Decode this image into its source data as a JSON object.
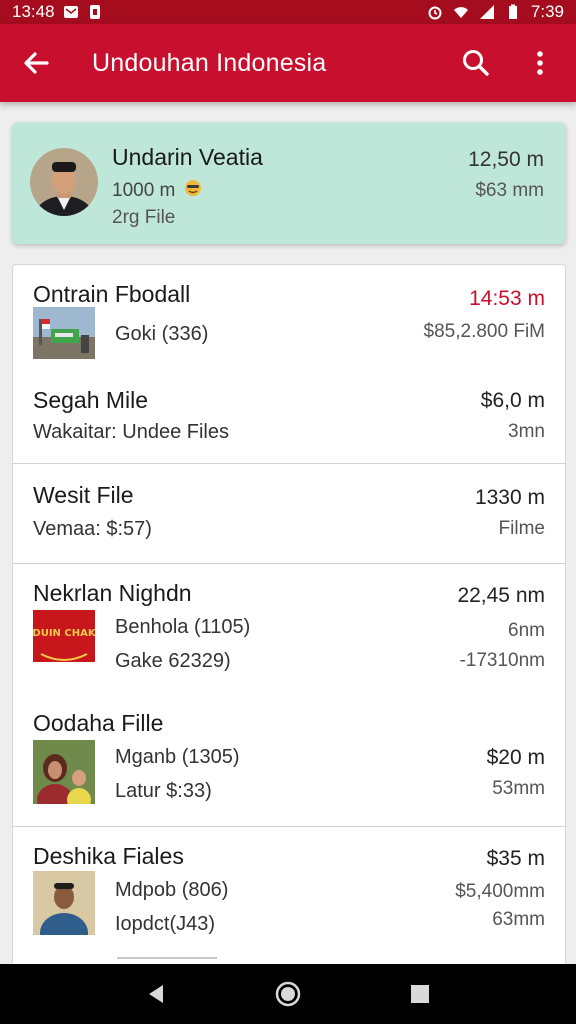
{
  "status_bar": {
    "time_left": "13:48",
    "time_right": "7:39"
  },
  "app_bar": {
    "title": "Undouhan Indonesia",
    "icons": [
      "back-arrow-icon",
      "search-icon",
      "more-vert-icon"
    ]
  },
  "featured": {
    "name": "Undarin Veatia",
    "meta": "1000 m",
    "sub": "2rg File",
    "right_top": "12,50 m",
    "right_bottom": "$63 mm"
  },
  "items": [
    {
      "title": "Ontrain Fbodall",
      "line1": "Goki (336)",
      "right1": "14:53 m",
      "right2": "$85,2.800 FiM"
    },
    {
      "title": "Segah Mile",
      "line1": "Wakaitar: Undee Files",
      "right1": "$6,0 m",
      "right2": "3mn"
    },
    {
      "title": "Wesit File",
      "line1": "Vemaa: $:57)",
      "right1": "1330 m",
      "right2": "Filme"
    },
    {
      "title": "Nekrlan Nighdn",
      "line1": "Benhola (1105)",
      "line2": "Gake 62329)",
      "right1": "22,45 nm",
      "right2": "6nm",
      "right3": "-17310nm",
      "thumb_text": "DUIN CHAK"
    },
    {
      "title": "Oodaha Fille",
      "line1": "Mganb (1305)",
      "line2": "Latur $:33)",
      "right1": "$20 m",
      "right2": "53mm"
    },
    {
      "title": "Deshika Fiales",
      "line1": "Mdpob (806)",
      "line2": "Iopdct(J43)",
      "right1": "$35 m",
      "right2": "$5,400mm",
      "right3": "63mm"
    }
  ],
  "colors": {
    "app_bar": "#c8102e",
    "status_bar": "#a50d1f",
    "featured_bg": "#bfe7d9",
    "accent_red": "#c8102e"
  },
  "nav_icons": [
    "back-triangle-icon",
    "home-circle-icon",
    "recents-square-icon"
  ]
}
